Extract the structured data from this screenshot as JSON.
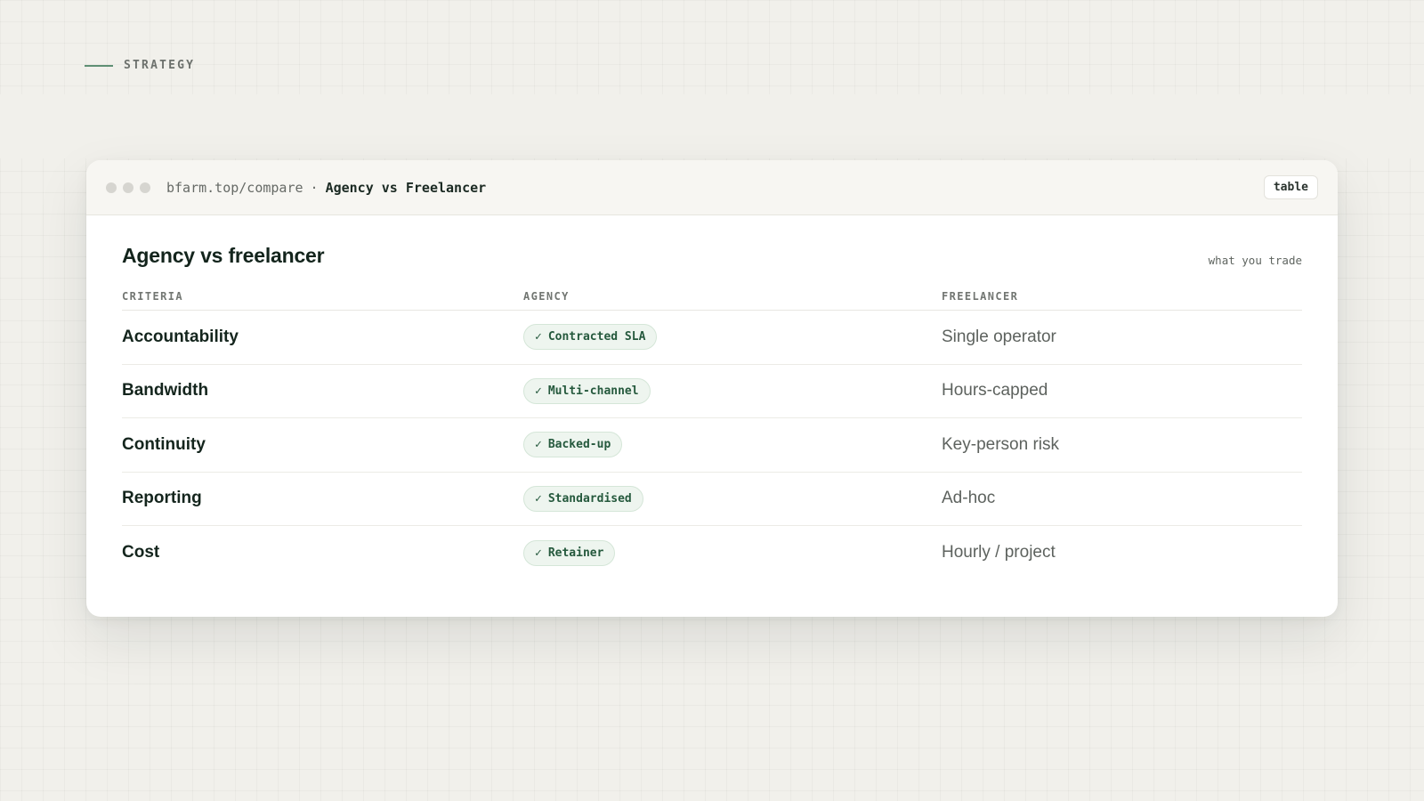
{
  "section": {
    "eyebrow": "STRATEGY"
  },
  "window": {
    "url": "bfarm.top/compare",
    "separator": "·",
    "page_title": "Agency vs Freelancer",
    "view_badge": "table"
  },
  "card": {
    "title": "Agency vs freelancer",
    "note": "what you trade",
    "columns": [
      "CRITERIA",
      "AGENCY",
      "FREELANCER"
    ],
    "rows": [
      {
        "criteria": "Accountability",
        "agency": "Contracted SLA",
        "freelancer": "Single operator"
      },
      {
        "criteria": "Bandwidth",
        "agency": "Multi-channel",
        "freelancer": "Hours-capped"
      },
      {
        "criteria": "Continuity",
        "agency": "Backed-up",
        "freelancer": "Key-person risk"
      },
      {
        "criteria": "Reporting",
        "agency": "Standardised",
        "freelancer": "Ad-hoc"
      },
      {
        "criteria": "Cost",
        "agency": "Retainer",
        "freelancer": "Hourly / project"
      }
    ]
  },
  "icons": {
    "check": "check-icon",
    "window_dots": "window-control-dots"
  },
  "colors": {
    "accent": "#5f8f74",
    "pill_bg": "#eef5ef",
    "pill_text": "#25593d"
  }
}
